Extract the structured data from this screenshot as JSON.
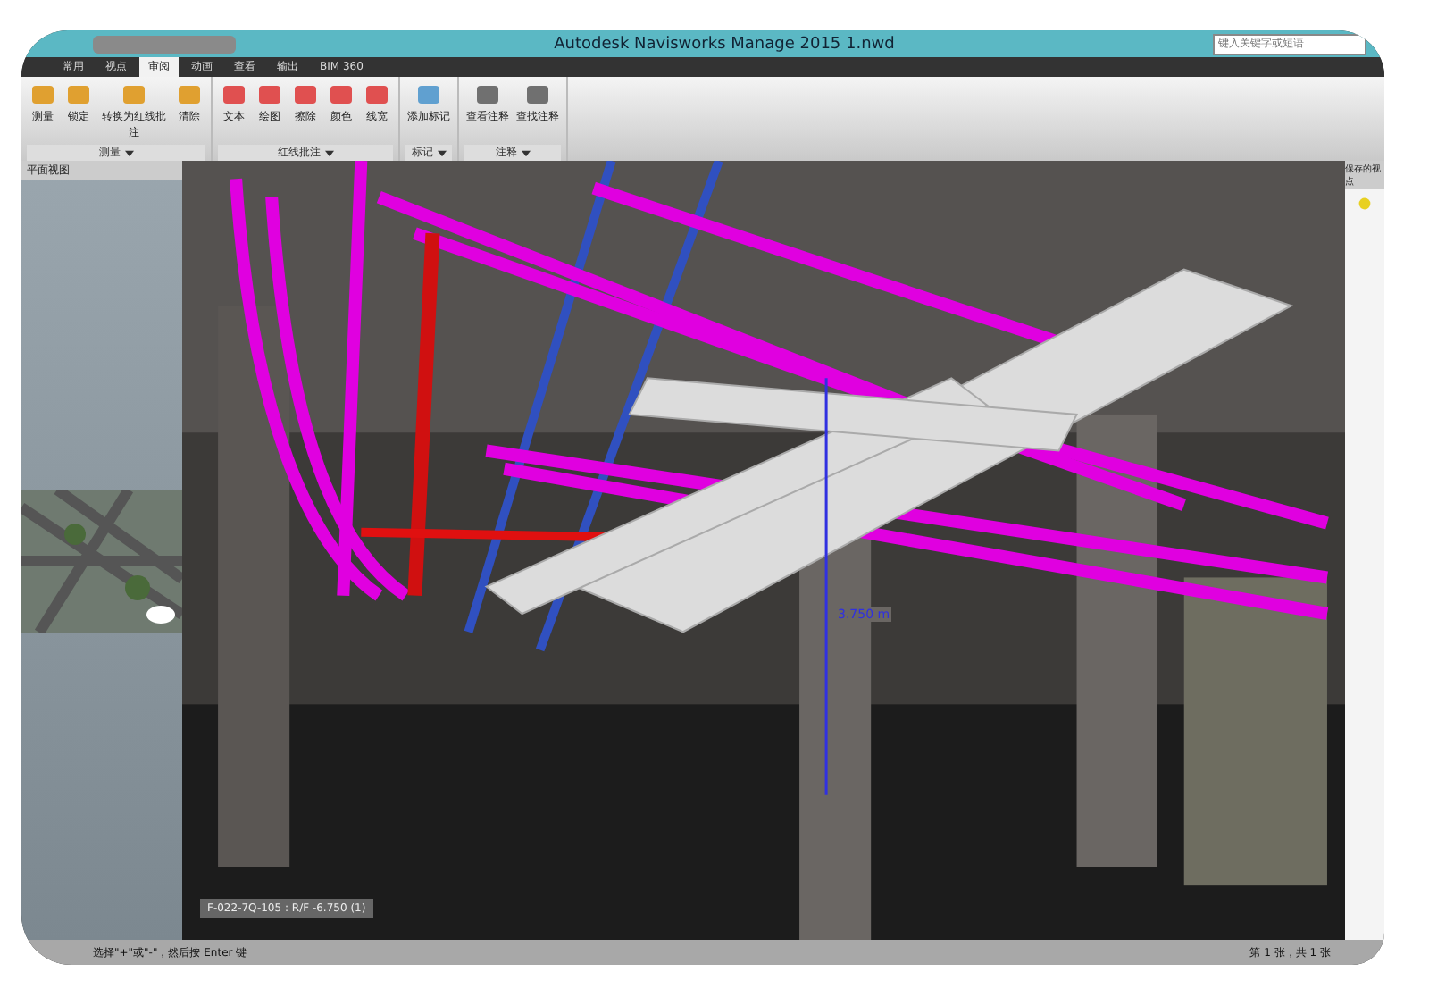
{
  "window": {
    "title": "Autodesk Navisworks Manage 2015    1.nwd",
    "search": {
      "placeholder": "键入关键字或短语"
    }
  },
  "tabs": [
    {
      "label": "常用",
      "selected": false
    },
    {
      "label": "视点",
      "selected": false
    },
    {
      "label": "审阅",
      "selected": true
    },
    {
      "label": "动画",
      "selected": false
    },
    {
      "label": "查看",
      "selected": false
    },
    {
      "label": "输出",
      "selected": false
    },
    {
      "label": "BIM 360",
      "selected": false
    }
  ],
  "ribbon_groups": [
    {
      "label": "测量",
      "tools": [
        {
          "label": "测量"
        },
        {
          "label": "锁定"
        },
        {
          "label": "转换为红线批注"
        },
        {
          "label": "清除"
        }
      ]
    },
    {
      "label": "红线批注",
      "tools": [
        {
          "label": "文本"
        },
        {
          "label": "绘图"
        },
        {
          "label": "擦除"
        },
        {
          "label": "颜色"
        },
        {
          "label": "线宽"
        }
      ]
    },
    {
      "label": "标记",
      "tools": [
        {
          "label": "添加标记"
        }
      ]
    },
    {
      "label": "注释",
      "tools": [
        {
          "label": "查看注释"
        },
        {
          "label": "查找注释"
        }
      ]
    }
  ],
  "left_panel": {
    "title": "平面视图"
  },
  "viewport": {
    "dimension": "3.750 m",
    "tag": "F-022-7Q-105 : R/F -6.750 (1)"
  },
  "right_panel": {
    "title": "保存的视点"
  },
  "status_bar": {
    "hint": "选择\"+\"或\"-\"，然后按 Enter 键",
    "page": "第 1 张，共 1 张"
  }
}
